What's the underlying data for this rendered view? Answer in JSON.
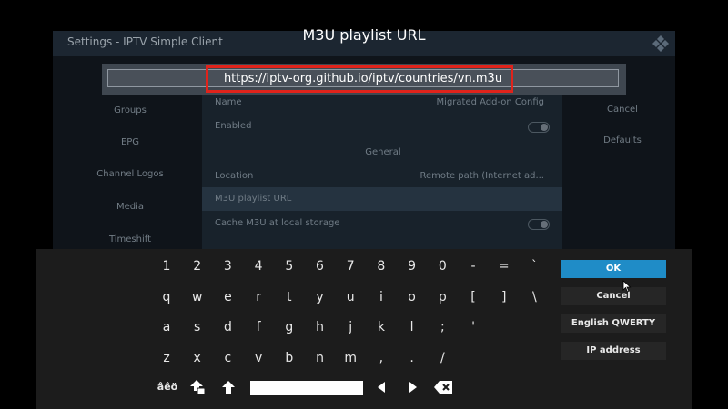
{
  "heading": "M3U playlist URL",
  "input": {
    "value": "https://iptv-org.github.io/iptv/countries/vn.m3u"
  },
  "background": {
    "title": "Settings - IPTV Simple Client",
    "categories": [
      "Groups",
      "EPG",
      "Channel Logos",
      "Media",
      "Timeshift"
    ],
    "side_buttons": [
      "Cancel",
      "Defaults"
    ],
    "rows": [
      {
        "label": "Name",
        "value": "Migrated Add-on Config"
      },
      {
        "label": "Enabled",
        "value": ""
      },
      {
        "label": "General",
        "value": ""
      },
      {
        "label": "Location",
        "value": "Remote path (Internet ad..."
      },
      {
        "label": "M3U playlist URL",
        "value": ""
      },
      {
        "label": "Cache M3U at local storage",
        "value": ""
      }
    ]
  },
  "keyboard": {
    "rows": [
      [
        "1",
        "2",
        "3",
        "4",
        "5",
        "6",
        "7",
        "8",
        "9",
        "0",
        "-",
        "=",
        "`"
      ],
      [
        "q",
        "w",
        "e",
        "r",
        "t",
        "y",
        "u",
        "i",
        "o",
        "p",
        "[",
        "]",
        "\\"
      ],
      [
        "a",
        "s",
        "d",
        "f",
        "g",
        "h",
        "j",
        "k",
        "l",
        ";",
        "'"
      ],
      [
        "z",
        "x",
        "c",
        "v",
        "b",
        "n",
        "m",
        ",",
        ".",
        "/"
      ]
    ],
    "symbols_key": "âêö",
    "buttons": {
      "ok": "OK",
      "cancel": "Cancel",
      "layout": "English QWERTY",
      "ip": "IP address"
    },
    "accent_color": "#1f8cc7"
  },
  "highlight_color": "#e0231b"
}
